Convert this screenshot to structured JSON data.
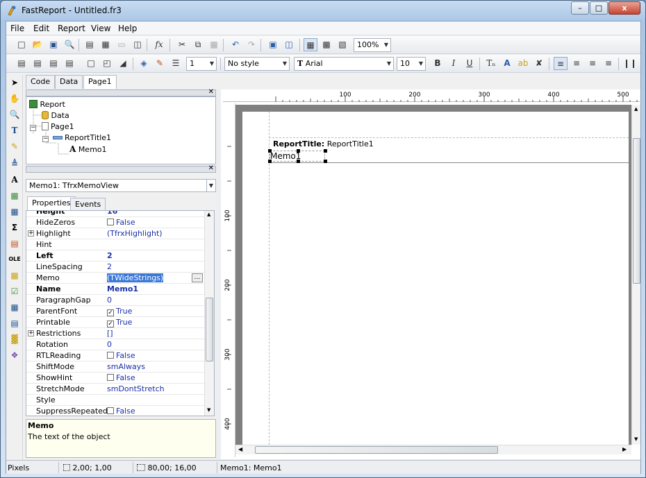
{
  "window": {
    "title": "FastReport - Untitled.fr3",
    "minimize": "–",
    "maximize": "□",
    "close": "x"
  },
  "menu": [
    "File",
    "Edit",
    "Report",
    "View",
    "Help"
  ],
  "toolbar1": {
    "zoom": "100%"
  },
  "toolbar2": {
    "frame_width": "1",
    "style": "No style",
    "font": "Arial",
    "font_size": "10",
    "bold": "B",
    "italic": "I",
    "underline": "U"
  },
  "tabs": [
    "Code",
    "Data",
    "Page1"
  ],
  "tree": [
    {
      "label": "Report",
      "icon": "report-icon"
    },
    {
      "label": "Data",
      "icon": "database-icon"
    },
    {
      "label": "Page1",
      "icon": "page-icon"
    },
    {
      "label": "ReportTitle1",
      "icon": "band-icon"
    },
    {
      "label": "Memo1",
      "icon": "text-A-icon"
    }
  ],
  "object_selector": "Memo1: TfrxMemoView",
  "inspector_tabs": [
    "Properties",
    "Events"
  ],
  "properties": [
    {
      "name": "Height",
      "value": "16",
      "bold": true
    },
    {
      "name": "HideZeros",
      "value": "False",
      "checkbox": false
    },
    {
      "name": "Highlight",
      "value": "(TfrxHighlight)",
      "expand": true
    },
    {
      "name": "Hint",
      "value": ""
    },
    {
      "name": "Left",
      "value": "2",
      "bold": true
    },
    {
      "name": "LineSpacing",
      "value": "2"
    },
    {
      "name": "Memo",
      "value": "(TWideStrings)",
      "selected": true
    },
    {
      "name": "Name",
      "value": "Memo1",
      "bold": true
    },
    {
      "name": "ParagraphGap",
      "value": "0"
    },
    {
      "name": "ParentFont",
      "value": "True",
      "checkbox": true
    },
    {
      "name": "Printable",
      "value": "True",
      "checkbox": true
    },
    {
      "name": "Restrictions",
      "value": "[]",
      "expand": true
    },
    {
      "name": "Rotation",
      "value": "0"
    },
    {
      "name": "RTLReading",
      "value": "False",
      "checkbox": false
    },
    {
      "name": "ShiftMode",
      "value": "smAlways"
    },
    {
      "name": "ShowHint",
      "value": "False",
      "checkbox": false
    },
    {
      "name": "StretchMode",
      "value": "smDontStretch"
    },
    {
      "name": "Style",
      "value": ""
    },
    {
      "name": "SuppressRepeated",
      "value": "False",
      "checkbox": false
    }
  ],
  "help": {
    "title": "Memo",
    "text": "The text of the object"
  },
  "ruler_h": [
    "100",
    "200",
    "300",
    "400",
    "500"
  ],
  "ruler_v": [
    "100",
    "200",
    "300",
    "400"
  ],
  "band": {
    "label_bold": "ReportTitle:",
    "label_name": "ReportTitle1",
    "memo_text": "Memo1"
  },
  "status": {
    "units": "Pixels",
    "position": "2,00; 1,00",
    "size": "80,00; 16,00",
    "object": "Memo1: Memo1"
  }
}
